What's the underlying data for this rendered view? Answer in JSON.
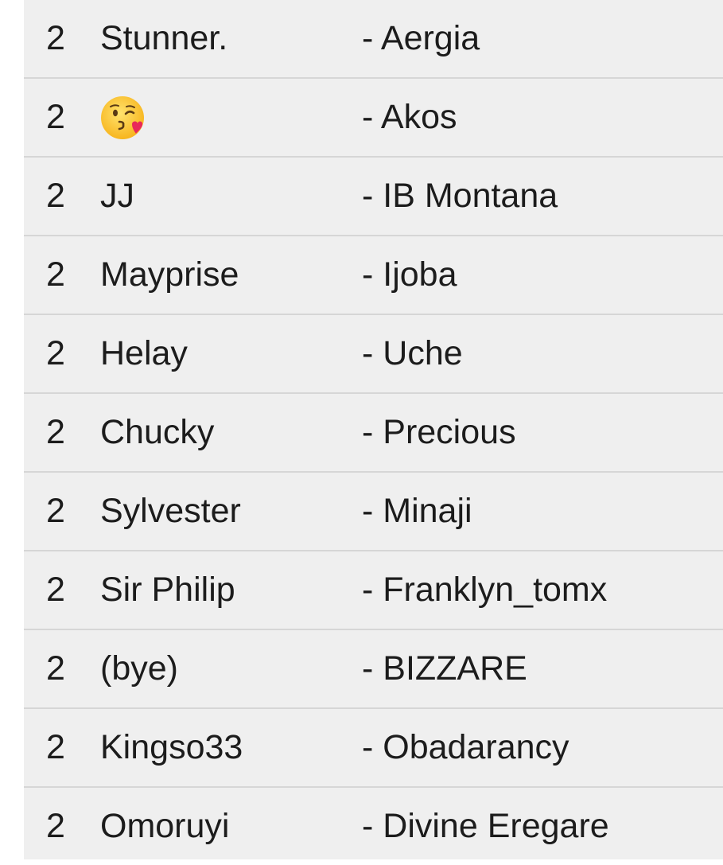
{
  "rows": [
    {
      "count": "2",
      "name": "Stunner.",
      "partner": "- Aergia"
    },
    {
      "count": "2",
      "name": "",
      "name_icon": "kissing-face-icon",
      "partner": "- Akos"
    },
    {
      "count": "2",
      "name": "JJ",
      "partner": "- IB Montana"
    },
    {
      "count": "2",
      "name": "Mayprise",
      "partner": "- Ijoba"
    },
    {
      "count": "2",
      "name": "Helay",
      "partner": "- Uche"
    },
    {
      "count": "2",
      "name": "Chucky",
      "partner": "- Precious"
    },
    {
      "count": "2",
      "name": "Sylvester",
      "partner": "- Minaji"
    },
    {
      "count": "2",
      "name": "Sir Philip",
      "partner": "- Franklyn_tomx"
    },
    {
      "count": "2",
      "name": "(bye)",
      "partner": "- BIZZARE"
    },
    {
      "count": "2",
      "name": "Kingso33",
      "partner": "- Obadarancy"
    },
    {
      "count": "2",
      "name": "Omoruyi",
      "partner": "- Divine Eregare"
    }
  ]
}
